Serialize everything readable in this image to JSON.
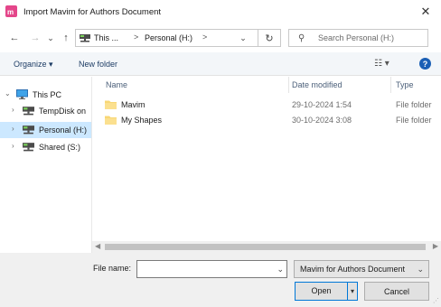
{
  "window": {
    "title": "Import Mavim for Authors Document",
    "close_glyph": "✕",
    "icon": "mavim-app-icon"
  },
  "nav": {
    "back_glyph": "←",
    "forward_glyph": "→",
    "recent_glyph": "⌄",
    "up_glyph": "↑",
    "address": {
      "crumbs": [
        "This ...",
        "Personal (H:)"
      ],
      "separator": ">",
      "dropdown_glyph": "⌄"
    },
    "refresh_glyph": "↻",
    "search": {
      "placeholder": "Search Personal (H:)",
      "icon": "search-icon"
    }
  },
  "toolbar": {
    "organize_label": "Organize ▾",
    "new_folder_label": "New folder",
    "view_glyph": "☷ ▾",
    "help_glyph": "?"
  },
  "tree": {
    "items": [
      {
        "label": "This PC",
        "chevron": "⌄",
        "icon": "computer-icon"
      },
      {
        "label": "TempDisk on",
        "chevron": "›",
        "icon": "network-drive-icon"
      },
      {
        "label": "Personal (H:)",
        "chevron": "›",
        "icon": "network-drive-icon",
        "selected": true
      },
      {
        "label": "Shared (S:)",
        "chevron": "›",
        "icon": "network-drive-icon"
      }
    ]
  },
  "files": {
    "columns": [
      "Name",
      "Date modified",
      "Type"
    ],
    "rows": [
      {
        "name": "Mavim",
        "date": "29-10-2024 1:54",
        "type": "File folder"
      },
      {
        "name": "My Shapes",
        "date": "30-10-2024 3:08",
        "type": "File folder"
      }
    ]
  },
  "footer": {
    "file_name_label": "File name:",
    "file_name_value": "",
    "file_type_value": "Mavim for Authors Document",
    "dropdown_glyph": "⌄",
    "open_label": "Open",
    "open_dropdown_glyph": "▾",
    "cancel_label": "Cancel"
  },
  "colors": {
    "accent": "#0078d7",
    "selection": "#cce8ff",
    "folder": "#f8d775",
    "app_icon": "#e4468a"
  }
}
